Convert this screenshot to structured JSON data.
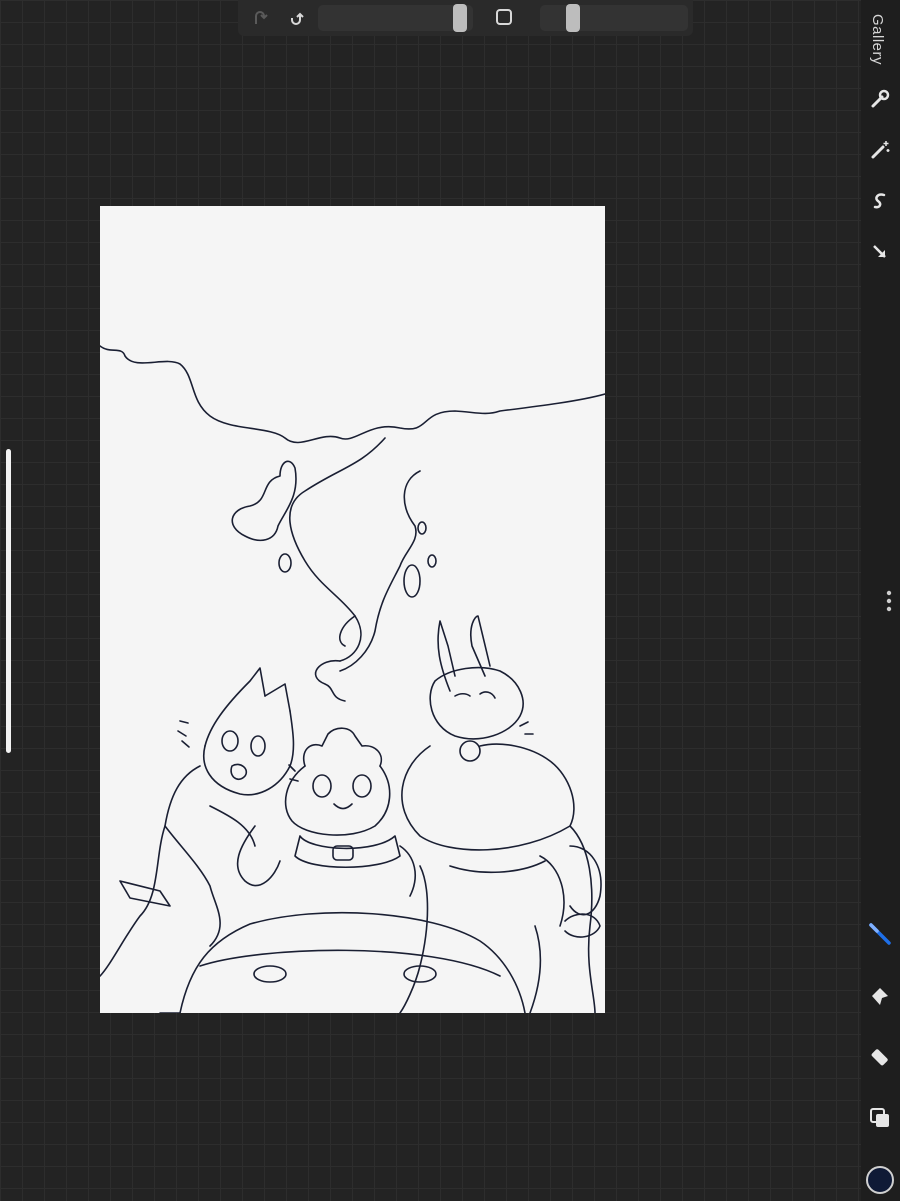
{
  "app": {
    "sidebar": {
      "gallery_label": "Gallery"
    },
    "icons": {
      "top": [
        "redo-icon",
        "undo-icon",
        "brush-size-slider",
        "modify-square-button",
        "opacity-slider"
      ],
      "right": [
        "wrench-icon",
        "magic-wand-icon",
        "selection-icon",
        "transform-arrow-icon",
        "more-options-icon",
        "brush-icon",
        "smudge-icon",
        "eraser-icon",
        "layers-icon",
        "color-picker"
      ]
    },
    "colors": {
      "background": "#232323",
      "accent_brush": "#1e6fe8",
      "current_color": "#0f1a36",
      "canvas": "#f5f5f5",
      "line_art": "#1a1f33"
    }
  }
}
